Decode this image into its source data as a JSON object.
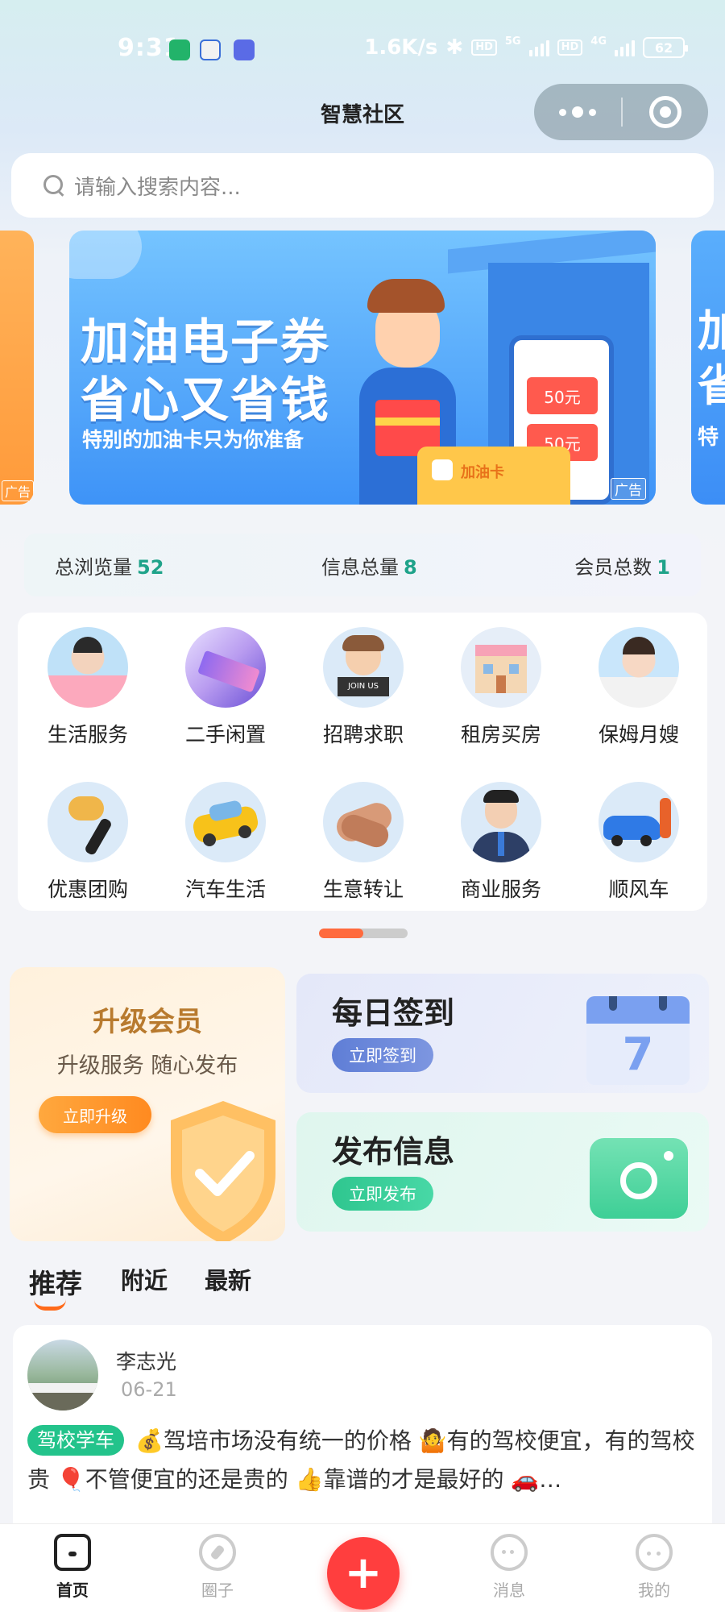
{
  "status_bar": {
    "time": "9:31",
    "net_speed": "1.6K/s",
    "bluetooth": "bluetooth-icon",
    "sim1": "5G",
    "sim2": "4G",
    "hd": "HD",
    "battery": "62"
  },
  "header": {
    "title": "智慧社区"
  },
  "search": {
    "placeholder": "请输入搜索内容..."
  },
  "banner": {
    "line1": "加油电子券",
    "line2": "省心又省钱",
    "subtitle": "特别的加油卡只为你准备",
    "coupon1": "50元",
    "coupon2": "50元",
    "card_label": "加油卡",
    "ad_label": "广告",
    "right_peek": "加",
    "right_peek2": "省",
    "right_peek3": "特"
  },
  "stats": {
    "views_label": "总浏览量",
    "views_value": "52",
    "info_label": "信息总量",
    "info_value": "8",
    "members_label": "会员总数",
    "members_value": "1"
  },
  "categories": [
    {
      "label": "生活服务",
      "icon": "housekeeper-icon"
    },
    {
      "label": "二手闲置",
      "icon": "phone-icon"
    },
    {
      "label": "招聘求职",
      "icon": "join-us-icon"
    },
    {
      "label": "租房买房",
      "icon": "house-icon"
    },
    {
      "label": "保姆月嫂",
      "icon": "nanny-icon"
    },
    {
      "label": "优惠团购",
      "icon": "group-buy-icon"
    },
    {
      "label": "汽车生活",
      "icon": "car-icon"
    },
    {
      "label": "生意转让",
      "icon": "handshake-icon"
    },
    {
      "label": "商业服务",
      "icon": "business-icon"
    },
    {
      "label": "顺风车",
      "icon": "rideshare-icon"
    }
  ],
  "pager": {
    "active_index": 0,
    "count": 2
  },
  "vip_card": {
    "title": "升级会员",
    "subtitle": "升级服务 随心发布",
    "button": "立即升级"
  },
  "sign_card": {
    "title": "每日签到",
    "button": "立即签到",
    "calendar_day": "7"
  },
  "post_card": {
    "title": "发布信息",
    "button": "立即发布"
  },
  "feed_tabs": [
    "推荐",
    "附近",
    "最新"
  ],
  "post": {
    "author": "李志光",
    "date": "06-21",
    "tag": "驾校学车",
    "text": "💰驾培市场没有统一的价格 🤷有的驾校便宜，有的驾校贵 🎈不管便宜的还是贵的 👍靠谱的才是最好的 🚗…"
  },
  "bottom_nav": [
    {
      "label": "首页",
      "active": true,
      "icon": "home-icon"
    },
    {
      "label": "圈子",
      "active": false,
      "icon": "compass-icon"
    },
    {
      "label": "+",
      "active": false,
      "icon": "plus-icon"
    },
    {
      "label": "消息",
      "active": false,
      "icon": "chat-icon"
    },
    {
      "label": "我的",
      "active": false,
      "icon": "profile-icon"
    }
  ],
  "colors": {
    "accent_green": "#1fa38a",
    "tag_green": "#23c38b",
    "publish_red": "#ff3e3e",
    "tab_orange": "#ff6a1a"
  }
}
